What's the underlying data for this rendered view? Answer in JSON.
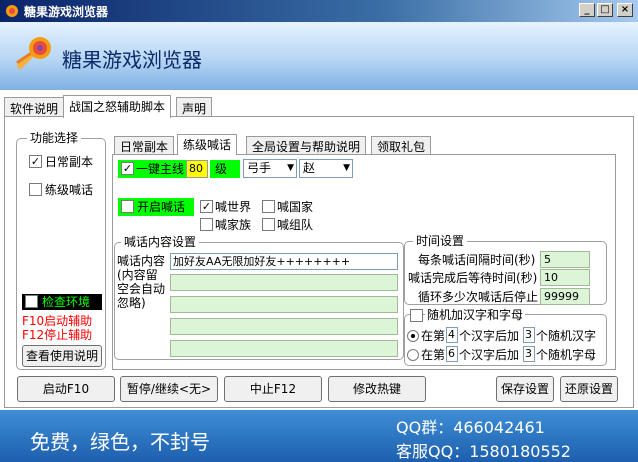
{
  "window": {
    "title": "糖果游戏浏览器",
    "app_name": "糖果游戏浏览器",
    "minimize": "_",
    "maximize": "□",
    "close": "×"
  },
  "outer_tabs": [
    "软件说明",
    "战国之怒辅助脚本",
    "声明"
  ],
  "func_select": {
    "title": "功能选择",
    "daily_dungeon": "日常副本",
    "level_shout": "练级喊话",
    "check_env": "检查环境",
    "hotkey_start": "F10启动辅助",
    "hotkey_stop": "F12停止辅助",
    "usage_button": "查看使用说明"
  },
  "inner_tabs": [
    "日常副本",
    "练级喊话",
    "全局设置与帮助说明",
    "领取礼包"
  ],
  "mainline": {
    "label": "一键主线",
    "level": "80",
    "level_unit": "级",
    "class_value": "弓手",
    "nation_value": "赵"
  },
  "shout": {
    "open_label": "开启喊话",
    "world": "喊世界",
    "nation": "喊国家",
    "family": "喊家族",
    "team": "喊组队"
  },
  "shout_content": {
    "title": "喊话内容设置",
    "label": "喊话内容",
    "hint": "(内容留空会自动忽略)",
    "line1": "加好友AA无限加好友++++++++"
  },
  "time_settings": {
    "title": "时间设置",
    "interval_label": "每条喊话间隔时间(秒)",
    "interval_value": "5",
    "wait_label": "喊话完成后等待时间(秒)",
    "wait_value": "10",
    "stop_label": "循环多少次喊话后停止",
    "stop_value": "99999"
  },
  "random": {
    "title": "随机加汉字和字母",
    "opt1_prefix": "在第",
    "opt1_n": "4",
    "opt1_mid": "个汉字后加",
    "opt1_m": "3",
    "opt1_suffix": "个随机汉字",
    "opt2_prefix": "在第",
    "opt2_n": "6",
    "opt2_mid": "个汉字后加",
    "opt2_m": "3",
    "opt2_suffix": "个随机字母"
  },
  "buttons": {
    "start": "启动F10",
    "pause": "暂停/继续<无>",
    "stop": "中止F12",
    "hotkey": "修改热键",
    "save": "保存设置",
    "restore": "还原设置"
  },
  "footer": {
    "slogan": "免费，绿色，不封号",
    "qq_group": "QQ群：466042461",
    "service_qq": "客服QQ：1580180552"
  },
  "colors": {
    "accent_green": "#00ff00",
    "accent_yellow": "#ffff00",
    "alert_red": "#ff0000"
  }
}
